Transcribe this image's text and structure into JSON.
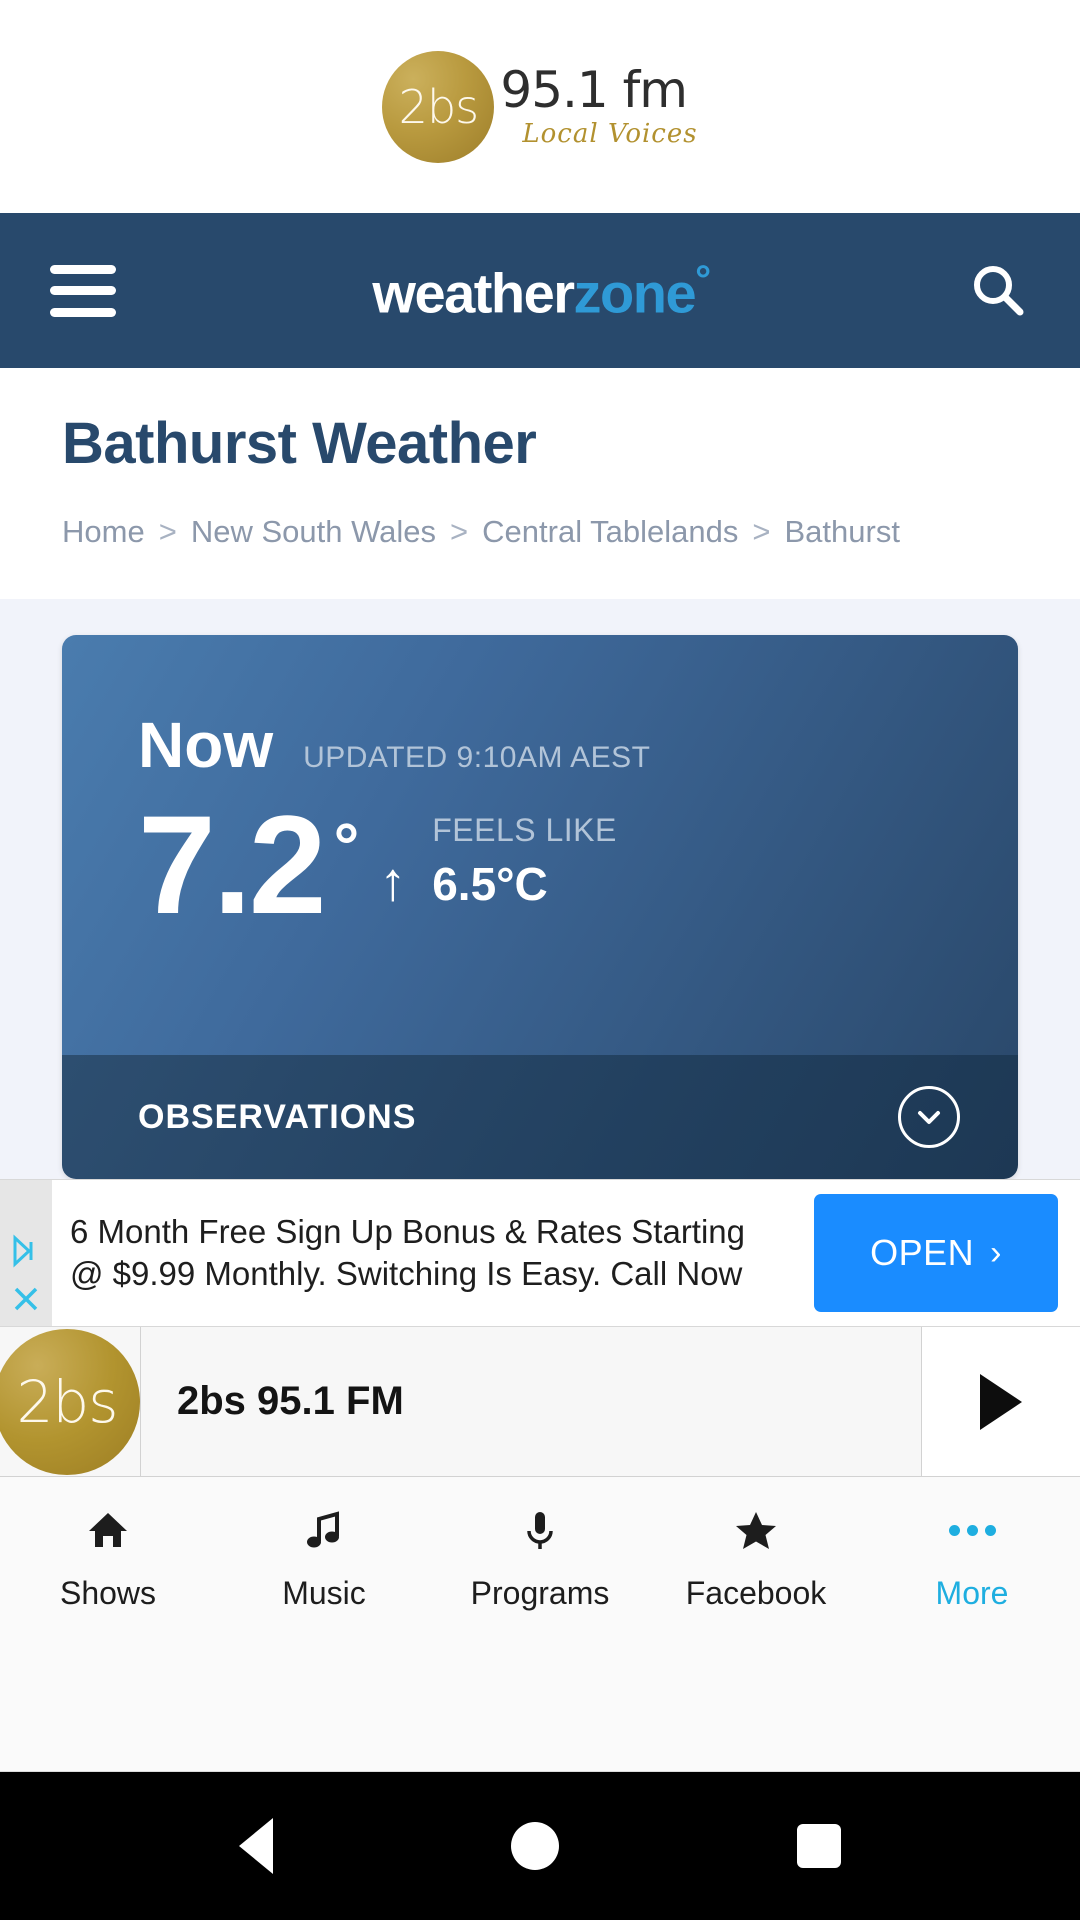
{
  "station": {
    "disc_text": "2bs",
    "frequency": "95.1 fm",
    "tagline": "Local Voices"
  },
  "header": {
    "menu_icon": "hamburger-menu-icon",
    "logo_part1": "weather",
    "logo_part2": "zone",
    "logo_degree": "°",
    "search_icon": "search-icon",
    "background_color": "#28496c"
  },
  "page": {
    "title": "Bathurst Weather",
    "breadcrumb": [
      "Home",
      "New South Wales",
      "Central Tablelands",
      "Bathurst"
    ],
    "breadcrumb_separator": ">"
  },
  "weather_card": {
    "now_label": "Now",
    "updated": "UPDATED 9:10AM AEST",
    "temperature": "7.2",
    "degree_symbol": "°",
    "trend_arrow": "↑",
    "feels_like_label": "FEELS LIKE",
    "feels_like_value": "6.5°C",
    "observations_label": "OBSERVATIONS",
    "expand_icon": "chevron-down-icon"
  },
  "ad": {
    "adchoices_icon": "adchoices-icon",
    "close_icon": "close-icon",
    "line1": "6 Month Free Sign Up Bonus & Rates Starting",
    "line2": "@ $9.99 Monthly. Switching Is Easy. Call Now",
    "button_label": "OPEN",
    "button_chevron": "›",
    "button_color": "#1a8cff"
  },
  "player": {
    "logo_text": "2bs",
    "station_name": "2bs 95.1 FM",
    "play_icon": "play-icon"
  },
  "tabs": [
    {
      "label": "Shows",
      "icon": "home-icon",
      "active": false
    },
    {
      "label": "Music",
      "icon": "music-note-icon",
      "active": false
    },
    {
      "label": "Programs",
      "icon": "microphone-icon",
      "active": false
    },
    {
      "label": "Facebook",
      "icon": "star-icon",
      "active": false
    },
    {
      "label": "More",
      "icon": "ellipsis-icon",
      "active": true
    }
  ],
  "android_nav": {
    "back": "back-icon",
    "home": "home-circle-icon",
    "recents": "recents-square-icon"
  }
}
